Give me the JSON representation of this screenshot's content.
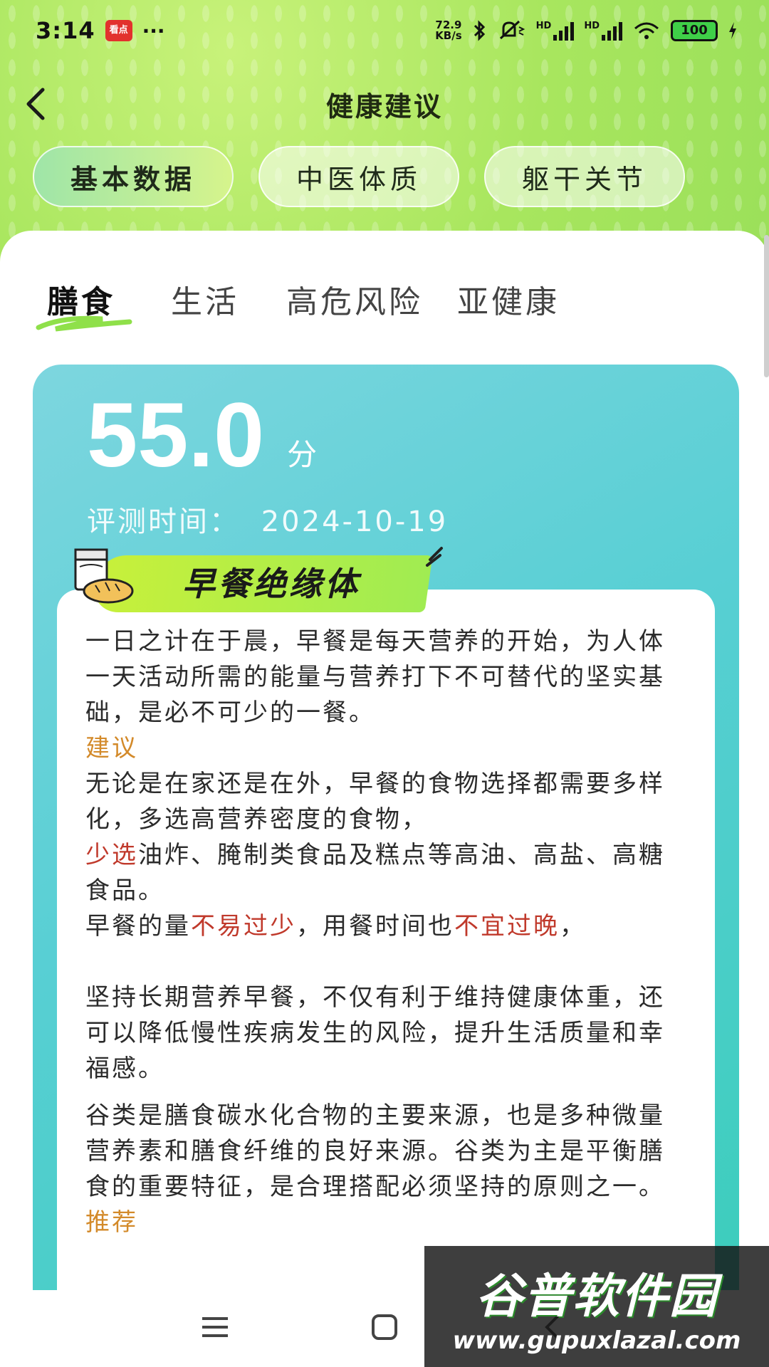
{
  "status_bar": {
    "time": "3:14",
    "app_icon_text": "看点",
    "more": "···",
    "net_speed_value": "72.9",
    "net_speed_unit": "KB/s",
    "sim_1": "HD",
    "sim_2": "HD",
    "battery": "100"
  },
  "header": {
    "title": "健康建议"
  },
  "top_tabs": [
    {
      "label": "基本数据",
      "active": true
    },
    {
      "label": "中医体质",
      "active": false
    },
    {
      "label": "躯干关节",
      "active": false
    }
  ],
  "sub_tabs": [
    {
      "label": "膳食",
      "active": true
    },
    {
      "label": "生活",
      "active": false
    },
    {
      "label": "高危风险",
      "active": false
    },
    {
      "label": "亚健康",
      "active": false
    }
  ],
  "score": {
    "value": "55.0",
    "unit": "分",
    "eval_label": "评测时间：",
    "eval_date": "2024-10-19"
  },
  "card": {
    "badge_title": "早餐绝缘体",
    "intro": "一日之计在于晨，早餐是每天营养的开始，为人体一天活动所需的能量与营养打下不可替代的坚实基础，是必不可少的一餐。",
    "advice_label": "建议",
    "advice_1": "无论是在家还是在外，早餐的食物选择都需要多样化，多选高营养密度的食物，",
    "advice_2_red": "少选",
    "advice_2_rest": "油炸、腌制类食品及糕点等高油、高盐、高糖食品。",
    "advice_3_a": "早餐的量",
    "advice_3_red1": "不易过少",
    "advice_3_b": "，用餐时间也",
    "advice_3_red2": "不宜过晚",
    "advice_3_c": "，",
    "advice_4": "坚持长期营养早餐，不仅有利于维持健康体重，还可以降低慢性疾病发生的风险，提升生活质量和幸福感。",
    "grain_text": "谷类是膳食碳水化合物的主要来源，也是多种微量营养素和膳食纤维的良好来源。谷类为主是平衡膳食的重要特征，是合理搭配必须坚持的原则之一。",
    "recommend_label": "推荐"
  },
  "watermark": {
    "name": "谷普软件园",
    "url": "www.gupuxlazal.com"
  },
  "colors": {
    "accent_green": "#a8e65e",
    "card_teal": "#58cfd4",
    "advice_orange": "#d38a2a",
    "warn_red": "#c0392b"
  }
}
